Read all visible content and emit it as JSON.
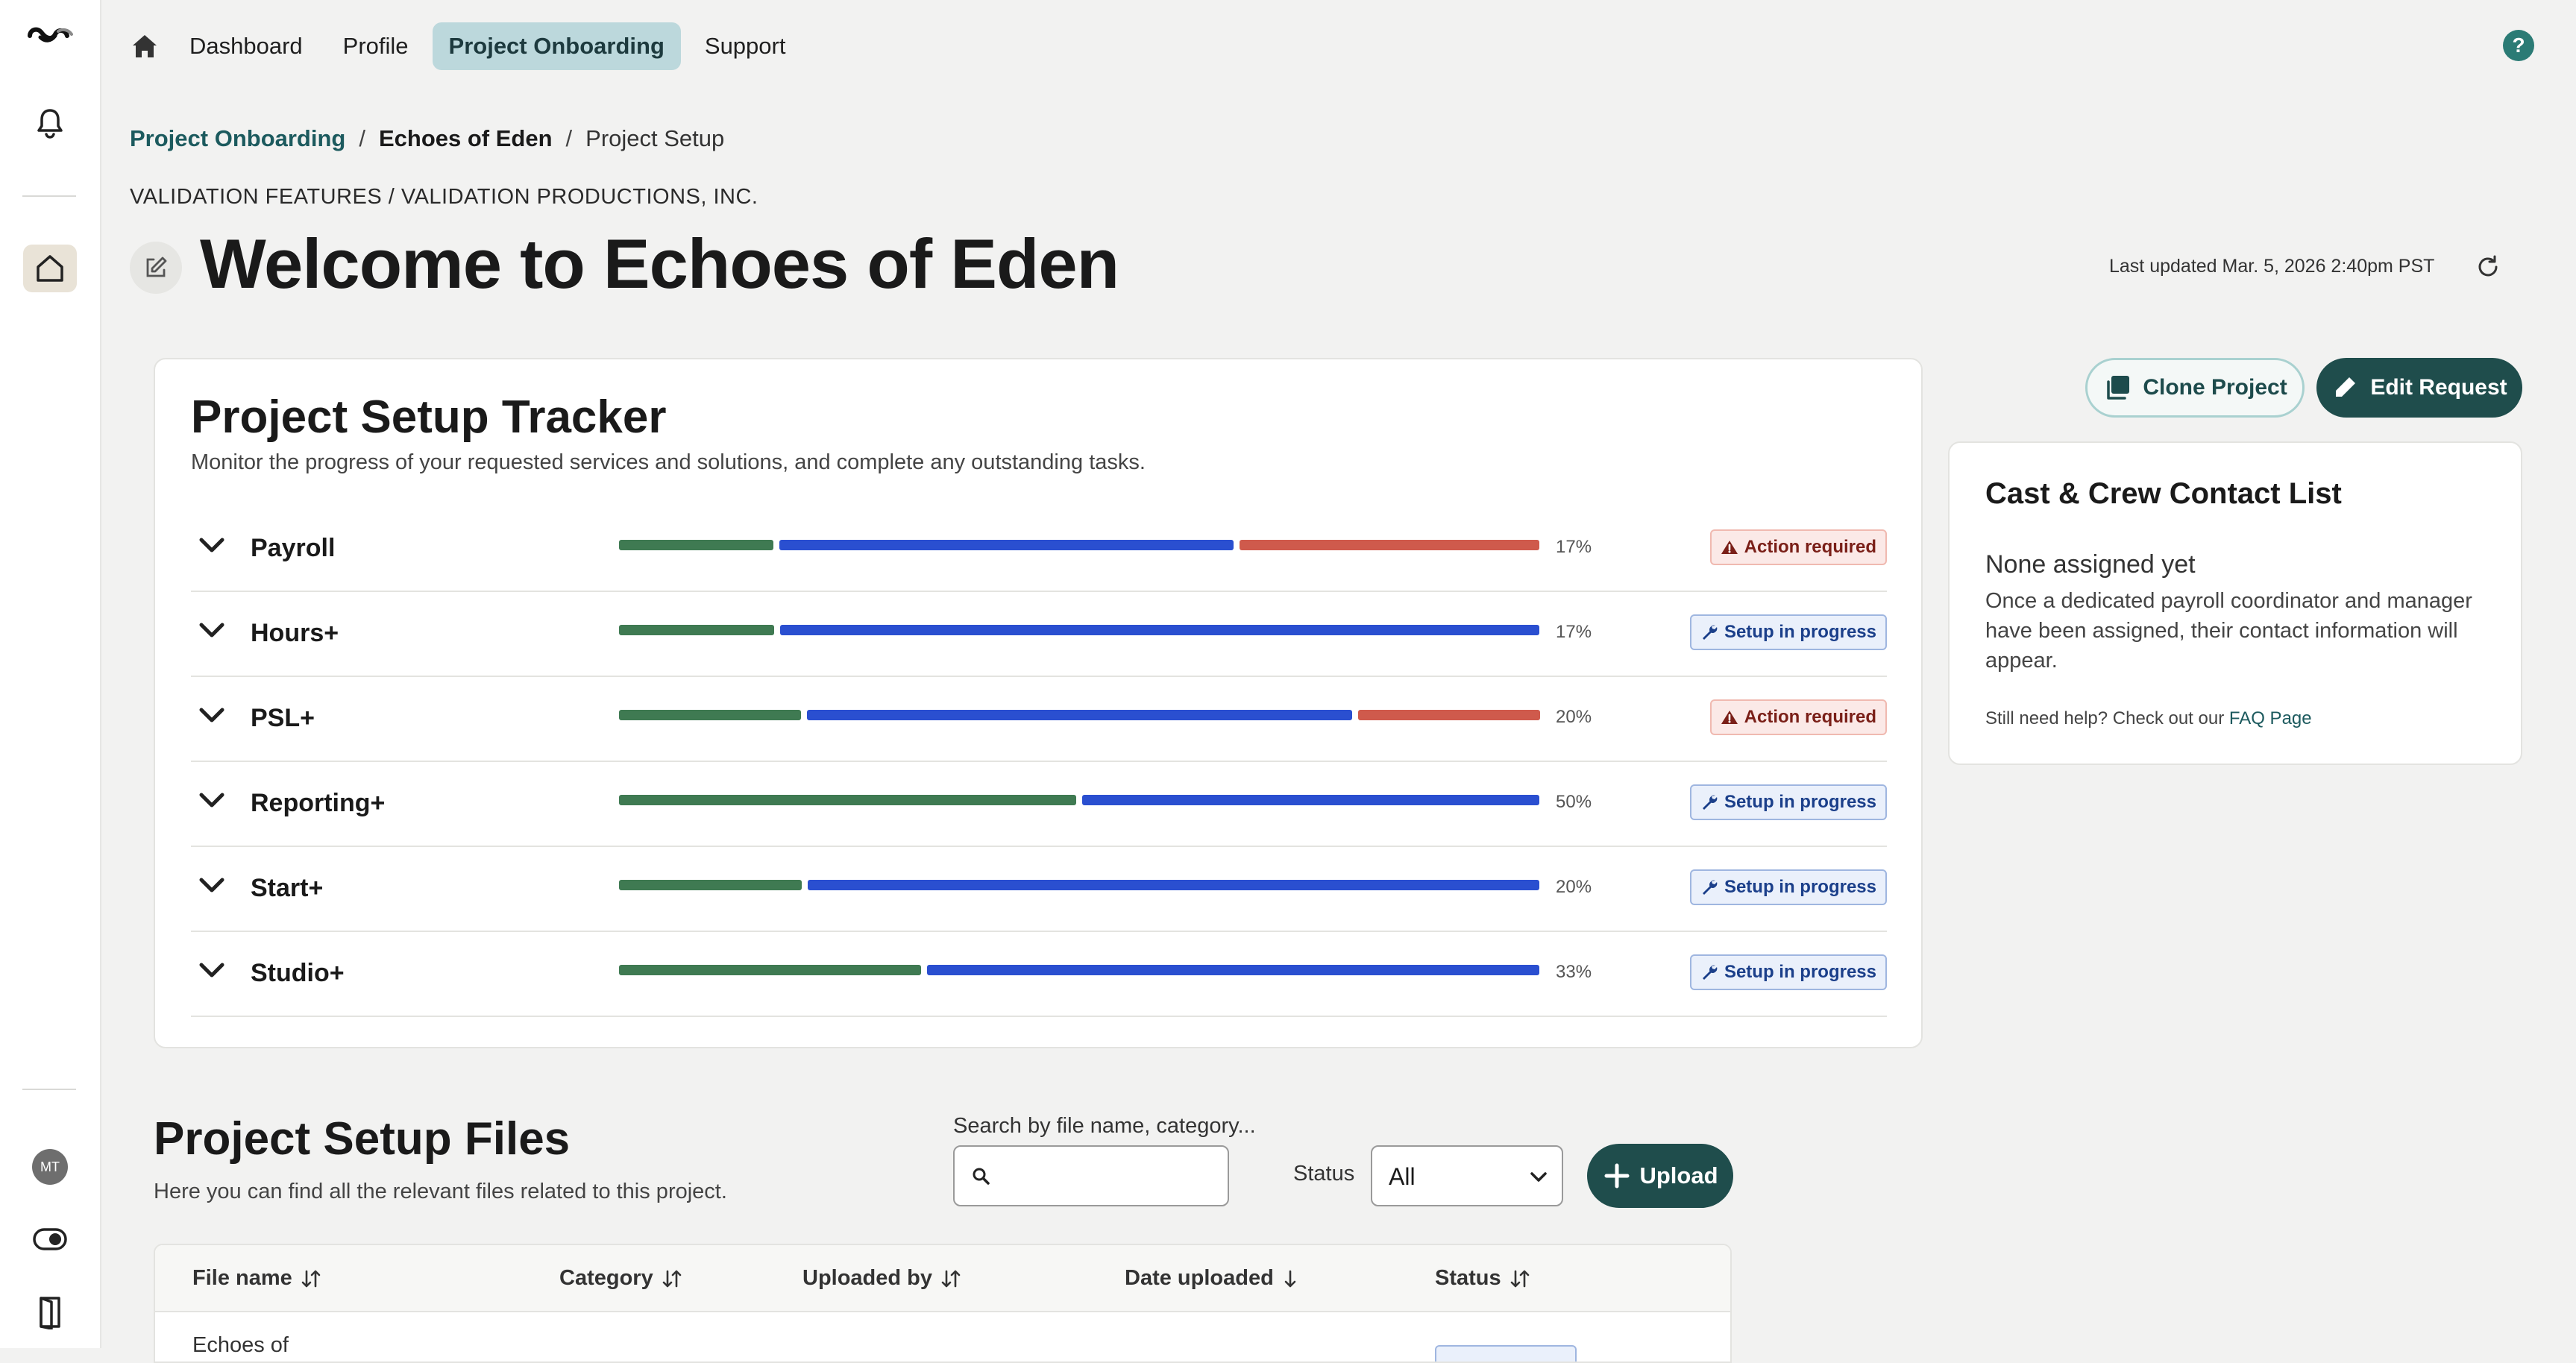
{
  "nav": {
    "items": [
      "Dashboard",
      "Profile",
      "Project Onboarding",
      "Support"
    ],
    "help": "?"
  },
  "sidebar": {
    "avatar_initials": "MT"
  },
  "breadcrumb": {
    "root": "Project Onboarding",
    "project": "Echoes of Eden",
    "current": "Project Setup",
    "separator": "/"
  },
  "company_path": "VALIDATION FEATURES / VALIDATION PRODUCTIONS, INC.",
  "page_title": "Welcome to Echoes of Eden",
  "last_updated": "Last updated Mar. 5, 2026 2:40pm PST",
  "tracker": {
    "title": "Project Setup Tracker",
    "subtitle": "Monitor the progress of your requested services and solutions, and complete any outstanding tasks.",
    "colors": {
      "complete": "#3f7a52",
      "in_progress": "#2a4fd0",
      "action": "#cf5a4c"
    },
    "services": [
      {
        "name": "Payroll",
        "percent": "17%",
        "status": "Action required",
        "status_type": "action",
        "segments": [
          0.17,
          0.5,
          0.33
        ]
      },
      {
        "name": "Hours+",
        "percent": "17%",
        "status": "Setup in progress",
        "status_type": "setup",
        "segments": [
          0.17,
          0.83,
          0
        ]
      },
      {
        "name": "PSL+",
        "percent": "20%",
        "status": "Action required",
        "status_type": "action",
        "segments": [
          0.2,
          0.6,
          0.2
        ]
      },
      {
        "name": "Reporting+",
        "percent": "50%",
        "status": "Setup in progress",
        "status_type": "setup",
        "segments": [
          0.5,
          0.5,
          0
        ]
      },
      {
        "name": "Start+",
        "percent": "20%",
        "status": "Setup in progress",
        "status_type": "setup",
        "segments": [
          0.2,
          0.8,
          0
        ]
      },
      {
        "name": "Studio+",
        "percent": "33%",
        "status": "Setup in progress",
        "status_type": "setup",
        "segments": [
          0.33,
          0.67,
          0
        ]
      }
    ]
  },
  "actions": {
    "clone": "Clone Project",
    "edit": "Edit Request"
  },
  "contact": {
    "title": "Cast & Crew Contact List",
    "none": "None assigned yet",
    "description": "Once a dedicated payroll coordinator and manager have been assigned, their contact information will appear.",
    "help_prefix": "Still need help? Check out our",
    "help_link": "FAQ Page"
  },
  "files": {
    "title": "Project Setup Files",
    "subtitle": "Here you can find all the relevant files related to this project.",
    "search_label": "Search by file name, category...",
    "search_value": "",
    "status_label": "Status",
    "status_value": "All",
    "upload": "Upload",
    "columns": [
      "File name",
      "Category",
      "Uploaded by",
      "Date uploaded",
      "Status"
    ],
    "first_row_partial": "Echoes of"
  }
}
